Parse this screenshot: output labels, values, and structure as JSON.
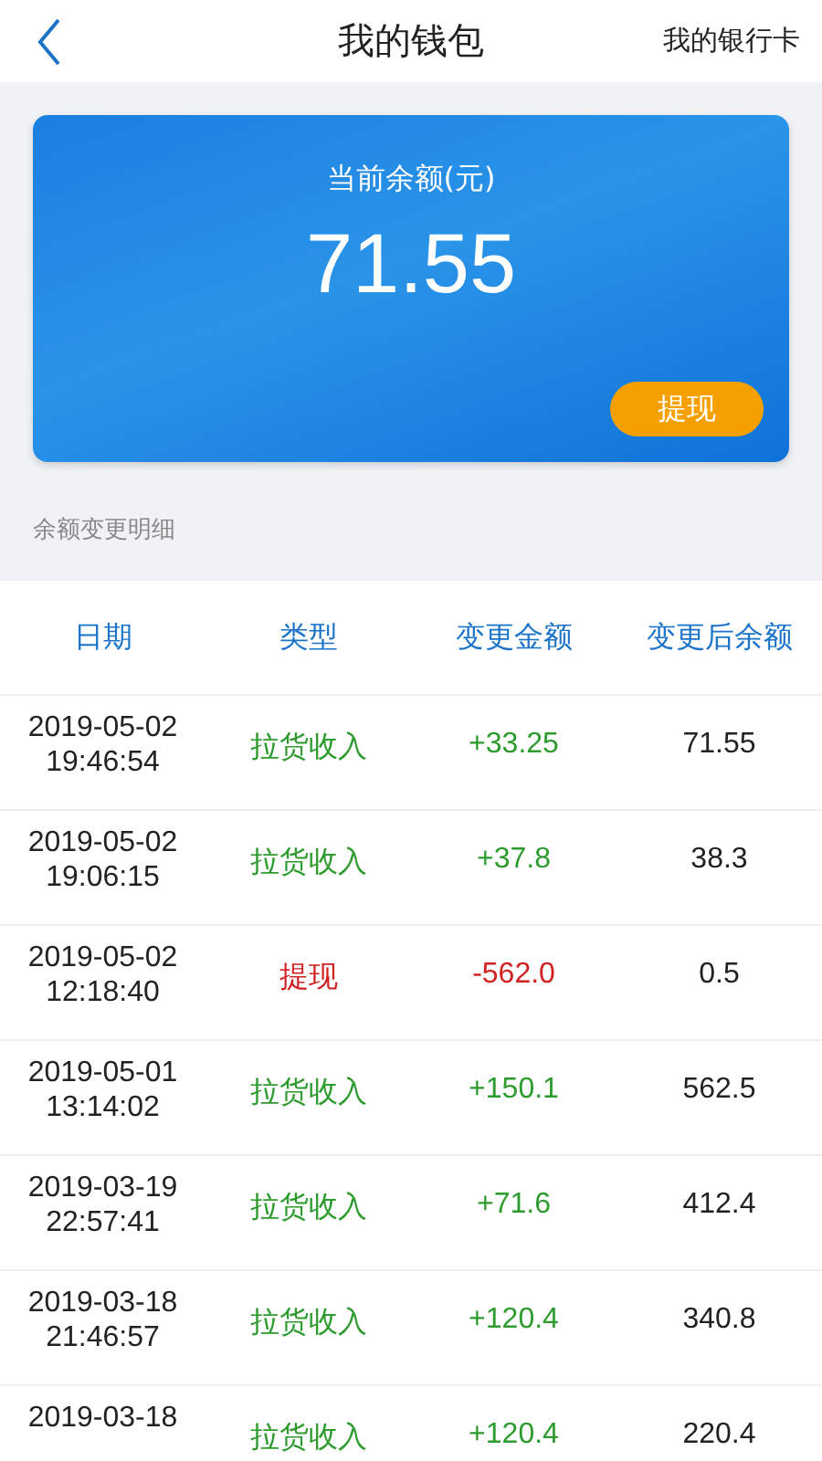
{
  "header": {
    "title": "我的钱包",
    "action": "我的银行卡"
  },
  "balance_card": {
    "label": "当前余额(元)",
    "amount": "71.55",
    "button": "提现"
  },
  "section_title": "余额变更明细",
  "table": {
    "columns": [
      "日期",
      "类型",
      "变更金额",
      "变更后余额"
    ],
    "rows": [
      {
        "kind": "income",
        "date": "2019-05-02",
        "time": "19:46:54",
        "type": "拉货收入",
        "change": "+33.25",
        "balance": "71.55"
      },
      {
        "kind": "income",
        "date": "2019-05-02",
        "time": "19:06:15",
        "type": "拉货收入",
        "change": "+37.8",
        "balance": "38.3"
      },
      {
        "kind": "withdraw",
        "date": "2019-05-02",
        "time": "12:18:40",
        "type": "提现",
        "change": "-562.0",
        "balance": "0.5"
      },
      {
        "kind": "income",
        "date": "2019-05-01",
        "time": "13:14:02",
        "type": "拉货收入",
        "change": "+150.1",
        "balance": "562.5"
      },
      {
        "kind": "income",
        "date": "2019-03-19",
        "time": "22:57:41",
        "type": "拉货收入",
        "change": "+71.6",
        "balance": "412.4"
      },
      {
        "kind": "income",
        "date": "2019-03-18",
        "time": "21:46:57",
        "type": "拉货收入",
        "change": "+120.4",
        "balance": "340.8"
      },
      {
        "kind": "income",
        "date": "2019-03-18",
        "type": "拉货收入",
        "change": "+120.4",
        "balance": "220.4"
      }
    ]
  }
}
